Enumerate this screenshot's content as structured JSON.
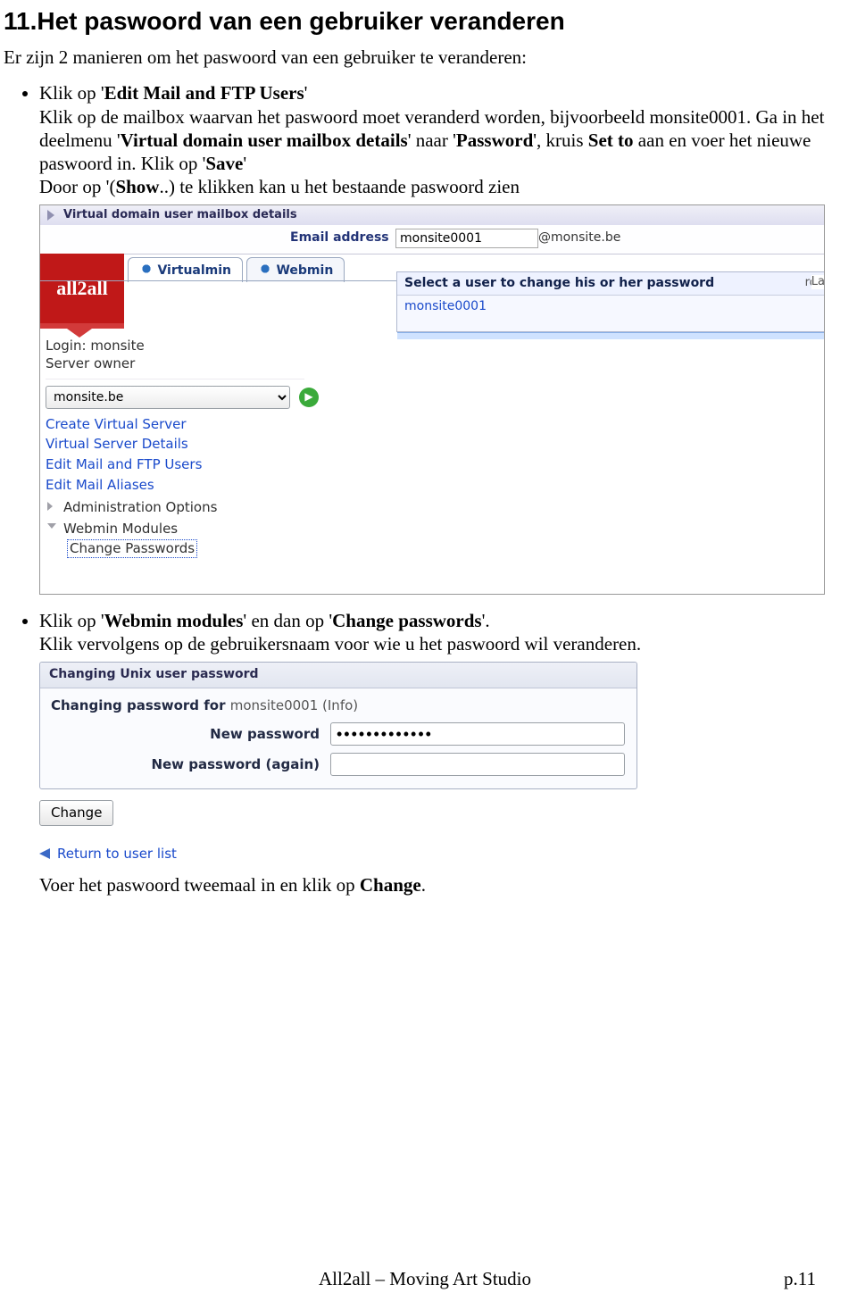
{
  "heading": "11.Het paswoord van een gebruiker veranderen",
  "intro": "Er zijn 2 manieren om het paswoord van een gebruiker te veranderen:",
  "bullet1": {
    "p1a": "Klik op '",
    "p1b": "Edit Mail and FTP Users",
    "p1c": "'",
    "p2a": "Klik op de mailbox waarvan het paswoord moet veranderd worden, bijvoorbeeld monsite0001.  Ga in het deelmenu '",
    "p2b": "Virtual domain user mailbox details",
    "p2c": "' naar '",
    "p2d": "Password",
    "p2e": "', kruis ",
    "p2f": "Set to",
    "p2g": " aan en voer het nieuwe paswoord in. Klik op '",
    "p2h": "Save",
    "p2i": "'",
    "p3a": "Door op '(",
    "p3b": "Show",
    "p3c": "..) te klikken kan u het bestaande paswoord zien"
  },
  "shot1": {
    "panel_title": "Virtual domain user mailbox details",
    "email_label": "Email address",
    "email_value": "monsite0001",
    "email_domain": "@monsite.be",
    "logo": "all2all",
    "tab1": "Virtualmin",
    "tab2": "Webmin",
    "login_lbl": "Login:",
    "login_val": "monsite",
    "role": "Server owner",
    "domain_option": "monsite.be",
    "menu": {
      "create": "Create Virtual Server",
      "details": "Virtual Server Details",
      "editmail": "Edit Mail and FTP Users",
      "aliases": "Edit Mail Aliases",
      "admin": "Administration Options",
      "webmin": "Webmin Modules",
      "changepw": "Change Passwords"
    },
    "right_header": "Select a user to change his or her password",
    "right_col_rd": "rd",
    "right_col_la": "La",
    "right_row": "monsite0001"
  },
  "bullet2": {
    "p1a": "Klik op '",
    "p1b": "Webmin modules",
    "p1c": "' en dan op '",
    "p1d": "Change passwords",
    "p1e": "'.",
    "p2": "Klik vervolgens op de gebruikersnaam voor wie u het paswoord wil veranderen.",
    "p3a": "Voer het paswoord tweemaal in en klik op ",
    "p3b": "Change",
    "p3c": "."
  },
  "shot2": {
    "box_title": "Changing Unix user password",
    "sub_a": "Changing password for ",
    "sub_user": "monsite0001 (Info)",
    "lbl_new": "New password",
    "lbl_again": "New password (again)",
    "pw_value": "•••••••••••••",
    "btn": "Change",
    "return": "Return to user list"
  },
  "footer_center": "All2all – Moving Art Studio",
  "footer_page": "p.11"
}
